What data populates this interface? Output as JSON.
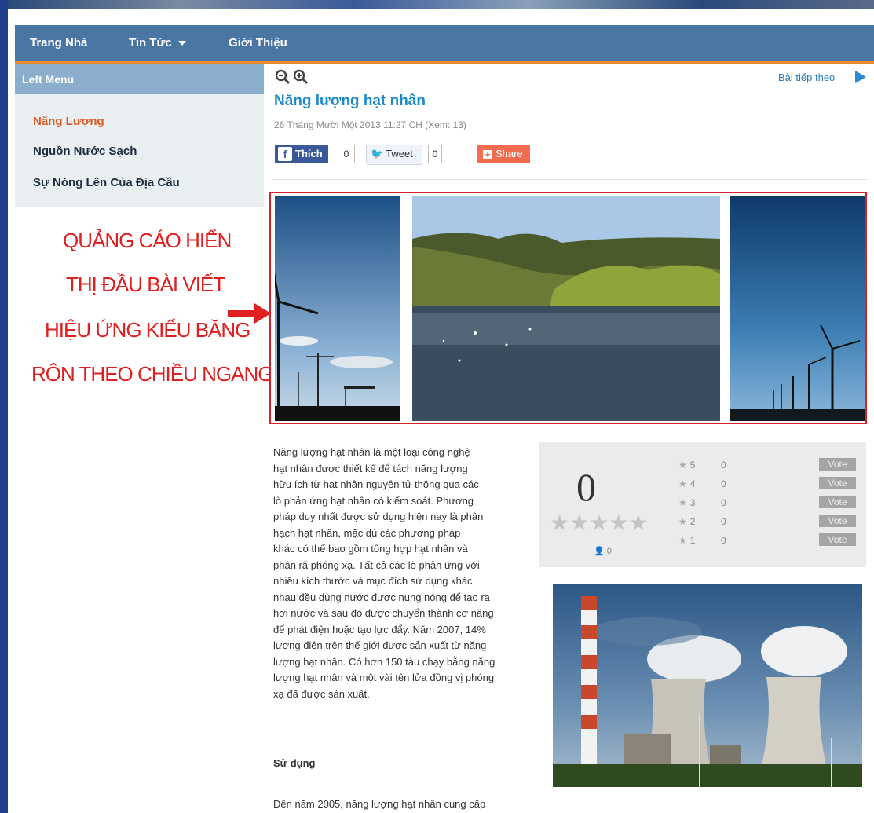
{
  "nav": {
    "items": [
      {
        "label": "Trang Nhà"
      },
      {
        "label": "Tin Tức"
      },
      {
        "label": "Giới Thiệu"
      }
    ]
  },
  "left_menu": {
    "title": "Left Menu",
    "items": [
      {
        "label": "Năng Lượng",
        "active": true
      },
      {
        "label": "Nguồn Nước Sạch",
        "active": false
      },
      {
        "label": "Sự Nóng Lên Của Địa Cầu",
        "active": false
      }
    ]
  },
  "ad_annotation": {
    "lines": [
      "QUẢNG CÁO HIỂN",
      "THỊ ĐẦU BÀI VIẾT",
      "HIỆU ỨNG KIỂU BĂNG",
      "RÔN THEO CHIỀU NGANG"
    ],
    "color": "#e02020"
  },
  "toolbar": {
    "zoom_out_icon": "zoom-out-icon",
    "zoom_in_icon": "zoom-in-icon",
    "next_label": "Bài tiếp theo"
  },
  "article": {
    "title": "Năng lượng hạt nhân",
    "meta": "26 Tháng Mười Một 2013  11:27 CH  (Xem: 13)",
    "social": {
      "like_label": "Thích",
      "like_count": "0",
      "tweet_label": "Tweet",
      "tweet_count": "0",
      "share_label": "Share"
    },
    "body_lines": [
      "Năng lượng hạt nhân là một loại công nghệ",
      "hạt nhân được thiết kế để tách năng lượng",
      "hữu ích từ hạt nhân nguyên tử thông qua các",
      "lò phản ứng hạt nhân có kiểm soát. Phương",
      "pháp duy nhất được sử dụng hiện nay là phân",
      "hạch hạt nhân, mặc dù các phương pháp",
      "khác có thể bao gồm tổng hợp hạt nhân và",
      "phân rã phóng xạ. Tất cả các lò phản ứng với",
      "nhiều kích thước và mục đích sử dụng khác",
      "nhau đều dùng nước được nung nóng để tạo ra",
      "hơi nước và sau đó được chuyển thành cơ năng",
      "để phát điện hoặc tạo lực đẩy. Năm 2007, 14%",
      "lượng điện trên thế giới được sản xuất từ năng",
      "lượng hạt nhân. Có hơn 150 tàu chạy bằng năng",
      "lượng hạt nhân và một vài tên lửa đồng vị phóng",
      "xạ đã được sản xuất."
    ],
    "section_heading": "Sử dụng",
    "section_start": "Đến năm 2005, năng lượng hạt nhân cung cấp"
  },
  "rating": {
    "average": "0",
    "voters": "0",
    "rows": [
      {
        "stars": "5",
        "count": "0",
        "vote_label": "Vote"
      },
      {
        "stars": "4",
        "count": "0",
        "vote_label": "Vote"
      },
      {
        "stars": "3",
        "count": "0",
        "vote_label": "Vote"
      },
      {
        "stars": "2",
        "count": "0",
        "vote_label": "Vote"
      },
      {
        "stars": "1",
        "count": "0",
        "vote_label": "Vote"
      }
    ]
  },
  "colors": {
    "nav_bg": "#4a76a3",
    "nav_accent": "#e98b2d",
    "title": "#1d8ac9",
    "active_menu": "#d85a26",
    "slider_border": "#d2232a"
  }
}
